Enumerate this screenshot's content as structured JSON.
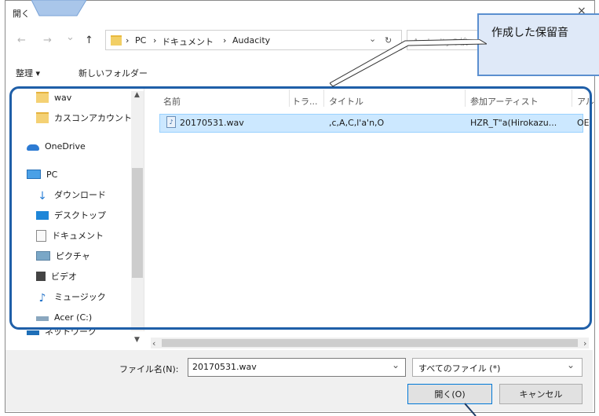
{
  "window": {
    "title": "開く",
    "close_glyph": "×"
  },
  "address": {
    "back_glyph": "←",
    "forward_glyph": "→",
    "recent_glyph": "⌄",
    "up_glyph": "↑",
    "crumbs": [
      "PC",
      "ドキュメント",
      "Audacity"
    ],
    "separator": "›",
    "dropdown_glyph": "⌄",
    "refresh_glyph": "↻",
    "search_placeholder": "Audacityの検"
  },
  "toolbar": {
    "organize_label": "整理 ▾",
    "new_folder_label": "新しいフォルダー"
  },
  "columns": {
    "name": "名前",
    "track": "トラ...",
    "title": "タイトル",
    "artist": "参加アーティスト",
    "album": "アル"
  },
  "sidebar": {
    "items": [
      {
        "label": "wav",
        "icon": "folder-icon"
      },
      {
        "label": "カスコンアカウント",
        "icon": "folder-icon"
      },
      {
        "label": "OneDrive",
        "icon": "onedrive-cloud-icon"
      },
      {
        "label": "PC",
        "icon": "pc-icon"
      },
      {
        "label": "ダウンロード",
        "icon": "download-icon"
      },
      {
        "label": "デスクトップ",
        "icon": "desktop-icon"
      },
      {
        "label": "ドキュメント",
        "icon": "documents-icon"
      },
      {
        "label": "ピクチャ",
        "icon": "pictures-icon"
      },
      {
        "label": "ビデオ",
        "icon": "videos-icon"
      },
      {
        "label": "ミュージック",
        "icon": "music-icon"
      },
      {
        "label": "Acer (C:)",
        "icon": "drive-icon"
      },
      {
        "label": "ネットワーク",
        "icon": "network-icon"
      }
    ],
    "scroll_up_glyph": "▲",
    "scroll_down_glyph": "▼"
  },
  "files": [
    {
      "name": "20170531.wav",
      "title": ",c,A,C,l'a'n,O",
      "artist": "HZR_T\"a(Hirokazu...",
      "album": "OE'"
    }
  ],
  "hscroll": {
    "left_glyph": "‹",
    "right_glyph": "›"
  },
  "bottom": {
    "filename_label": "ファイル名(N):",
    "filename_value": "20170531.wav",
    "dropdown_glyph": "⌄",
    "filetype_value": "すべてのファイル (*)",
    "open_label": "開く(O)",
    "cancel_label": "キャンセル"
  },
  "annotation": {
    "callout_text": "作成した保留音"
  },
  "colors": {
    "selection": "#cce8ff",
    "highlight_border": "#1f5fa8",
    "callout_fill": "#dfe9f8"
  }
}
